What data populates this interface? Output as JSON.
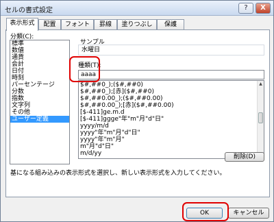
{
  "window": {
    "title": "セルの書式設定",
    "help_glyph": "?",
    "close_glyph": "X"
  },
  "tabs": [
    {
      "label": "表示形式",
      "active": true
    },
    {
      "label": "配置",
      "active": false
    },
    {
      "label": "フォント",
      "active": false
    },
    {
      "label": "罫線",
      "active": false
    },
    {
      "label": "塗りつぶし",
      "active": false
    },
    {
      "label": "保護",
      "active": false
    }
  ],
  "category": {
    "label": "分類(C):",
    "items": [
      "標準",
      "数値",
      "通貨",
      "会計",
      "日付",
      "時刻",
      "パーセンテージ",
      "分数",
      "指数",
      "文字列",
      "その他",
      "ユーザー定義"
    ],
    "selected_index": 11
  },
  "sample": {
    "label": "サンプル",
    "value": "水曜日"
  },
  "type": {
    "label": "種類(T):",
    "value": "aaaa",
    "formats": [
      "$#,##0_);($#,##0)",
      "$#,##0_);[赤]($#,##0)",
      "$#,##0.00_);($#,##0.00)",
      "$#,##0.00_);[赤]($#,##0.00)",
      "[$-411]ge.m.d",
      "[$-411]ggge\"年\"m\"月\"d\"日\"",
      "yyyy/m/d",
      "yyyy\"年\"m\"月\"d\"日\"",
      "yyyy\"年\"m\"月\"",
      "m\"月\"d\"日\"",
      "m/d/yy"
    ]
  },
  "delete_button": "削除(D)",
  "description": "基になる組み込みの表示形式を選択し、新しい表示形式を入力してください。",
  "ok_button": "OK",
  "cancel_button": "キャンセル",
  "highlight_color": "#e00000",
  "selection_color": "#3399ff"
}
